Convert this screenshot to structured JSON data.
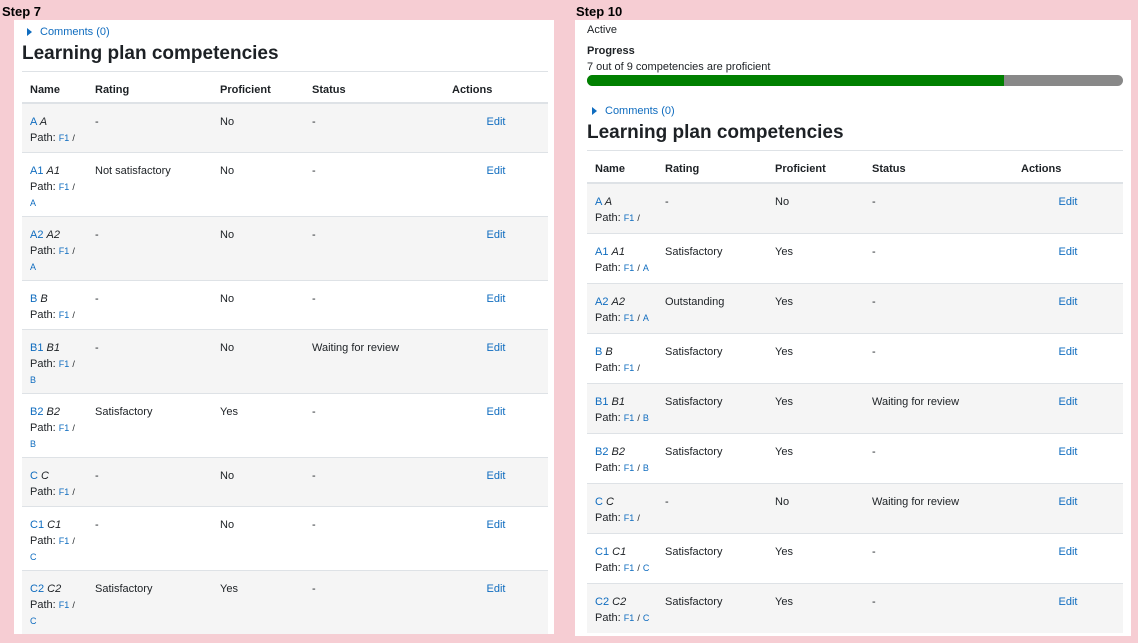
{
  "steps": {
    "left_label": "Step 7",
    "right_label": "Step 10"
  },
  "left": {
    "comments_label": "Comments (0)",
    "section_title": "Learning plan competencies",
    "columns": [
      "Name",
      "Rating",
      "Proficient",
      "Status",
      "Actions"
    ],
    "rows": [
      {
        "code": "A",
        "name": "A",
        "rating": "-",
        "proficient": "No",
        "status": "-",
        "action": "Edit",
        "path_prefix": "Path:",
        "path": [
          "F1",
          "/"
        ]
      },
      {
        "code": "A1",
        "name": "A1",
        "rating": "Not satisfactory",
        "proficient": "No",
        "status": "-",
        "action": "Edit",
        "path_prefix": "Path:",
        "path": [
          "F1",
          "/",
          "A"
        ]
      },
      {
        "code": "A2",
        "name": "A2",
        "rating": "-",
        "proficient": "No",
        "status": "-",
        "action": "Edit",
        "path_prefix": "Path:",
        "path": [
          "F1",
          "/",
          "A"
        ]
      },
      {
        "code": "B",
        "name": "B",
        "rating": "-",
        "proficient": "No",
        "status": "-",
        "action": "Edit",
        "path_prefix": "Path:",
        "path": [
          "F1",
          "/"
        ]
      },
      {
        "code": "B1",
        "name": "B1",
        "rating": "-",
        "proficient": "No",
        "status": "Waiting for review",
        "action": "Edit",
        "path_prefix": "Path:",
        "path": [
          "F1",
          "/",
          "B"
        ]
      },
      {
        "code": "B2",
        "name": "B2",
        "rating": "Satisfactory",
        "proficient": "Yes",
        "status": "-",
        "action": "Edit",
        "path_prefix": "Path:",
        "path": [
          "F1",
          "/",
          "B"
        ]
      },
      {
        "code": "C",
        "name": "C",
        "rating": "-",
        "proficient": "No",
        "status": "-",
        "action": "Edit",
        "path_prefix": "Path:",
        "path": [
          "F1",
          "/"
        ]
      },
      {
        "code": "C1",
        "name": "C1",
        "rating": "-",
        "proficient": "No",
        "status": "-",
        "action": "Edit",
        "path_prefix": "Path:",
        "path": [
          "F1",
          "/",
          "C"
        ]
      },
      {
        "code": "C2",
        "name": "C2",
        "rating": "Satisfactory",
        "proficient": "Yes",
        "status": "-",
        "action": "Edit",
        "path_prefix": "Path:",
        "path": [
          "F1",
          "/",
          "C"
        ]
      }
    ]
  },
  "right": {
    "status_text": "Active",
    "progress_label": "Progress",
    "progress_text": "7 out of 9 competencies are proficient",
    "progress_fraction": 0.778,
    "progress_fill_color": "#008000",
    "progress_track_color": "#888888",
    "comments_label": "Comments (0)",
    "section_title": "Learning plan competencies",
    "columns": [
      "Name",
      "Rating",
      "Proficient",
      "Status",
      "Actions"
    ],
    "rows": [
      {
        "code": "A",
        "name": "A",
        "rating": "-",
        "proficient": "No",
        "status": "-",
        "action": "Edit",
        "path_prefix": "Path:",
        "path": [
          "F1",
          "/"
        ]
      },
      {
        "code": "A1",
        "name": "A1",
        "rating": "Satisfactory",
        "proficient": "Yes",
        "status": "-",
        "action": "Edit",
        "path_prefix": "Path:",
        "path": [
          "F1",
          "/",
          "A"
        ]
      },
      {
        "code": "A2",
        "name": "A2",
        "rating": "Outstanding",
        "proficient": "Yes",
        "status": "-",
        "action": "Edit",
        "path_prefix": "Path:",
        "path": [
          "F1",
          "/",
          "A"
        ]
      },
      {
        "code": "B",
        "name": "B",
        "rating": "Satisfactory",
        "proficient": "Yes",
        "status": "-",
        "action": "Edit",
        "path_prefix": "Path:",
        "path": [
          "F1",
          "/"
        ]
      },
      {
        "code": "B1",
        "name": "B1",
        "rating": "Satisfactory",
        "proficient": "Yes",
        "status": "Waiting for review",
        "action": "Edit",
        "path_prefix": "Path:",
        "path": [
          "F1",
          "/",
          "B"
        ]
      },
      {
        "code": "B2",
        "name": "B2",
        "rating": "Satisfactory",
        "proficient": "Yes",
        "status": "-",
        "action": "Edit",
        "path_prefix": "Path:",
        "path": [
          "F1",
          "/",
          "B"
        ]
      },
      {
        "code": "C",
        "name": "C",
        "rating": "-",
        "proficient": "No",
        "status": "Waiting for review",
        "action": "Edit",
        "path_prefix": "Path:",
        "path": [
          "F1",
          "/"
        ]
      },
      {
        "code": "C1",
        "name": "C1",
        "rating": "Satisfactory",
        "proficient": "Yes",
        "status": "-",
        "action": "Edit",
        "path_prefix": "Path:",
        "path": [
          "F1",
          "/",
          "C"
        ]
      },
      {
        "code": "C2",
        "name": "C2",
        "rating": "Satisfactory",
        "proficient": "Yes",
        "status": "-",
        "action": "Edit",
        "path_prefix": "Path:",
        "path": [
          "F1",
          "/",
          "C"
        ]
      }
    ]
  }
}
